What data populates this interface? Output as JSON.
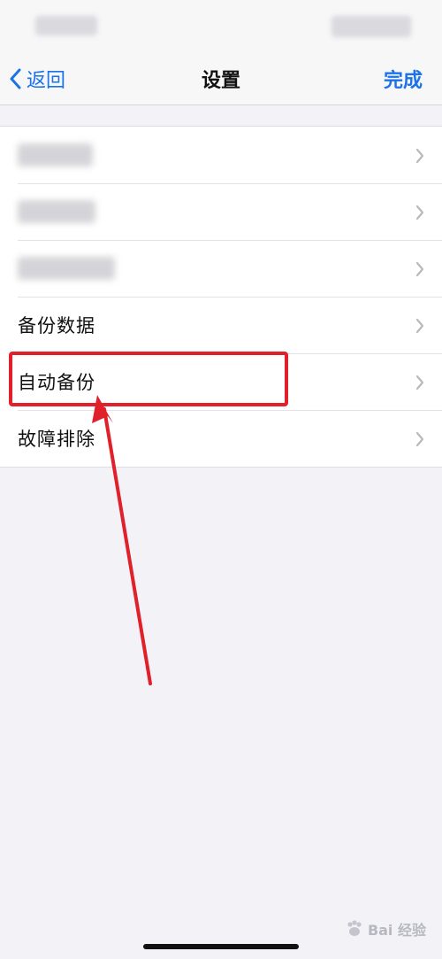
{
  "nav": {
    "back_label": "返回",
    "title": "设置",
    "done_label": "完成"
  },
  "settings_rows": [
    {
      "label": "",
      "obscured": true
    },
    {
      "label": "",
      "obscured": true
    },
    {
      "label": "",
      "obscured": true
    },
    {
      "label": "备份数据",
      "obscured": false
    },
    {
      "label": "自动备份",
      "obscured": false,
      "highlighted": true
    },
    {
      "label": "故障排除",
      "obscured": false
    }
  ],
  "annotation": {
    "highlight_color": "#e0202a",
    "target_row": "自动备份"
  },
  "watermark": {
    "text": "Bai 经验"
  },
  "colors": {
    "accent": "#1a73e8",
    "background": "#f2f2f7",
    "annotation": "#e0202a"
  }
}
